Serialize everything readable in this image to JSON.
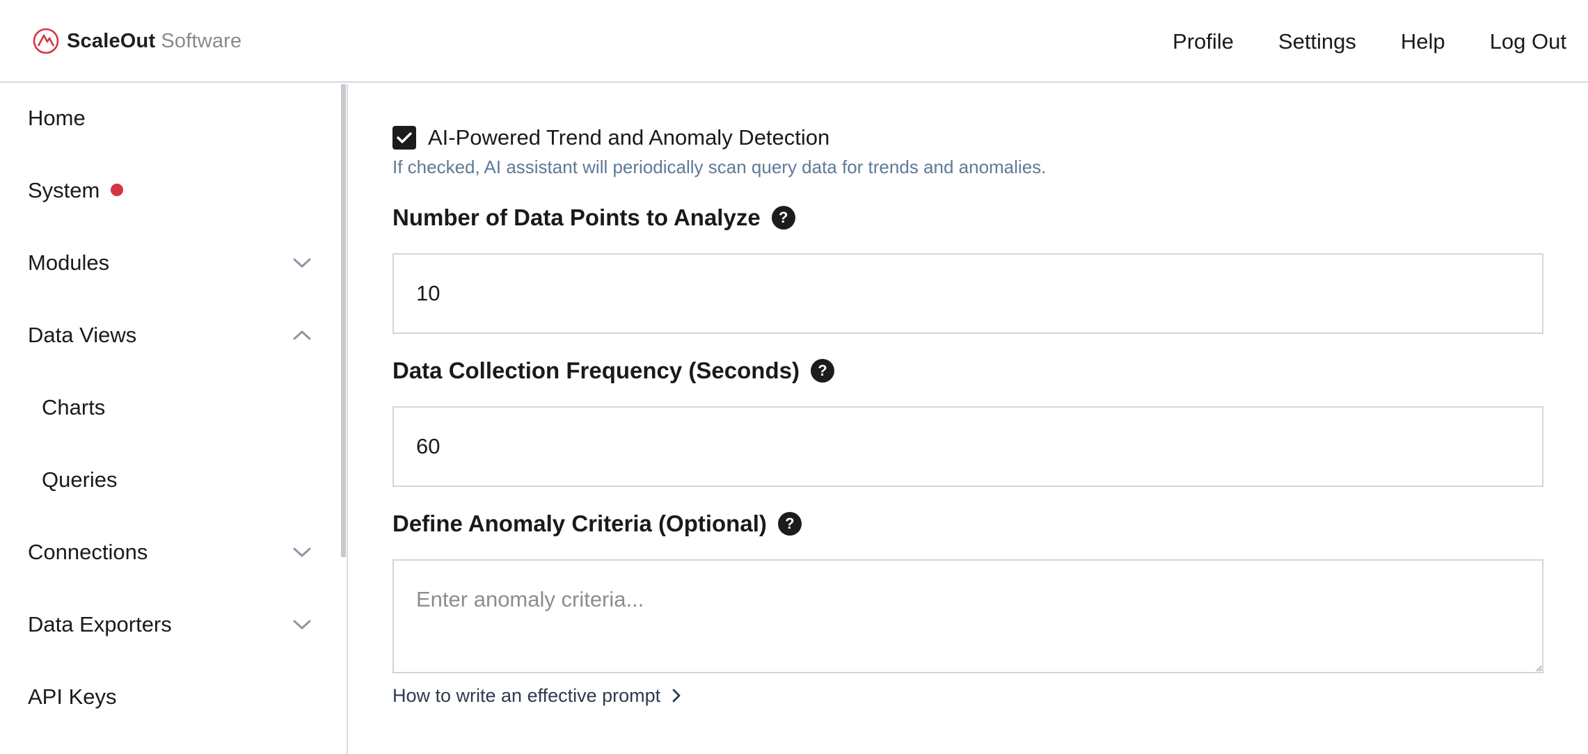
{
  "brand": {
    "name": "ScaleOut",
    "sub": "Software"
  },
  "topnav": [
    "Profile",
    "Settings",
    "Help",
    "Log Out"
  ],
  "sidebar": {
    "items": [
      {
        "label": "Home"
      },
      {
        "label": "System",
        "status": "alert"
      },
      {
        "label": "Modules",
        "chevron": "down"
      },
      {
        "label": "Data Views",
        "chevron": "up"
      },
      {
        "label": "Charts"
      },
      {
        "label": "Queries"
      },
      {
        "label": "Connections",
        "chevron": "down"
      },
      {
        "label": "Data Exporters",
        "chevron": "down"
      },
      {
        "label": "API Keys"
      }
    ]
  },
  "form": {
    "ai_detection": {
      "checked": true,
      "label": "AI-Powered Trend and Anomaly Detection",
      "helper": "If checked, AI assistant will periodically scan query data for trends and anomalies."
    },
    "data_points": {
      "label": "Number of Data Points to Analyze",
      "value": "10"
    },
    "frequency": {
      "label": "Data Collection Frequency (Seconds)",
      "value": "60"
    },
    "criteria": {
      "label": "Define Anomaly Criteria (Optional)",
      "placeholder": "Enter anomaly criteria...",
      "value": ""
    },
    "help_icon_glyph": "?",
    "prompt_link": "How to write an effective prompt"
  },
  "colors": {
    "accent": "#d63343",
    "helper_text": "#5e7a96",
    "border": "#cfd6dd",
    "dark": "#1c1c1c"
  }
}
